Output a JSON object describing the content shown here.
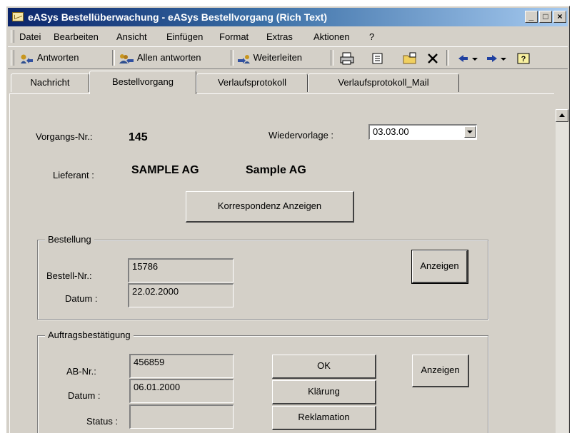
{
  "window": {
    "title": "eASys Bestellüberwachung - eASys Bestellvorgang (Rich Text)",
    "controls": [
      "_",
      "□",
      "×"
    ]
  },
  "menu": [
    "Datei",
    "Bearbeiten",
    "Ansicht",
    "Einfügen",
    "Format",
    "Extras",
    "Aktionen",
    "?"
  ],
  "toolbar": {
    "reply": "Antworten",
    "reply_all": "Allen antworten",
    "forward": "Weiterleiten"
  },
  "tabs": [
    "Nachricht",
    "Bestellvorgang",
    "Verlaufsprotokoll",
    "Verlaufsprotokoll_Mail"
  ],
  "form": {
    "vorgang_label": "Vorgangs-Nr.:",
    "vorgang_value": "145",
    "wiedervorlage_label": "Wiedervorlage :",
    "wiedervorlage_value": "03.03.00",
    "lieferant_label": "Lieferant :",
    "lieferant_value1": "SAMPLE AG",
    "lieferant_value2": "Sample AG",
    "korrespondenz_button": "Korrespondenz Anzeigen",
    "bestellung": {
      "title": "Bestellung",
      "nr_label": "Bestell-Nr.:",
      "nr_value": "15786",
      "datum_label": "Datum :",
      "datum_value": "22.02.2000",
      "anzeigen_button": "Anzeigen"
    },
    "auftrag": {
      "title": "Auftragsbestätigung",
      "nr_label": "AB-Nr.:",
      "nr_value": "456859",
      "datum_label": "Datum :",
      "datum_value": "06.01.2000",
      "status_label": "Status :",
      "status_value": "",
      "ok_button": "OK",
      "klaerung_button": "Klärung",
      "reklamation_button": "Reklamation",
      "anzeigen_button": "Anzeigen"
    }
  }
}
